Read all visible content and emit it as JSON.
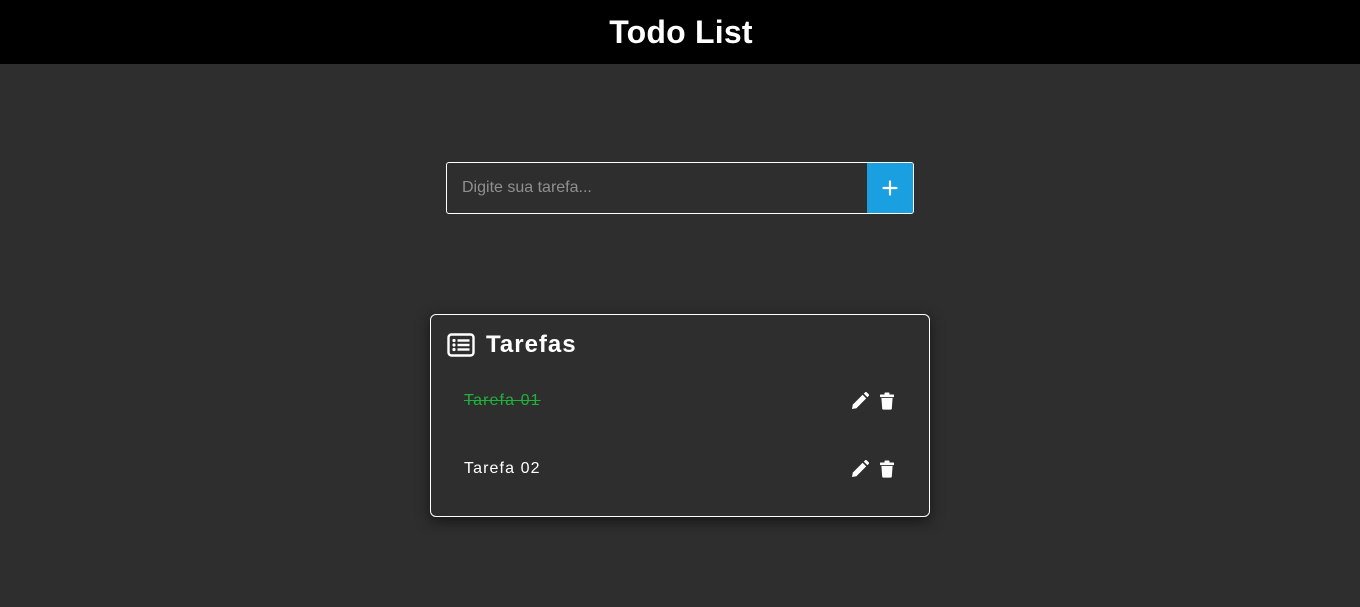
{
  "header": {
    "title": "Todo List"
  },
  "new_task": {
    "placeholder": "Digite sua tarefa...",
    "value": "",
    "add_label": "+"
  },
  "tasks_panel": {
    "title": "Tarefas",
    "items": [
      {
        "label": "Tarefa 01",
        "completed": true
      },
      {
        "label": "Tarefa 02",
        "completed": false
      }
    ]
  },
  "colors": {
    "background": "#2e2e2e",
    "header_bg": "#000000",
    "accent": "#1a9fe0",
    "completed": "#1fb23a"
  }
}
